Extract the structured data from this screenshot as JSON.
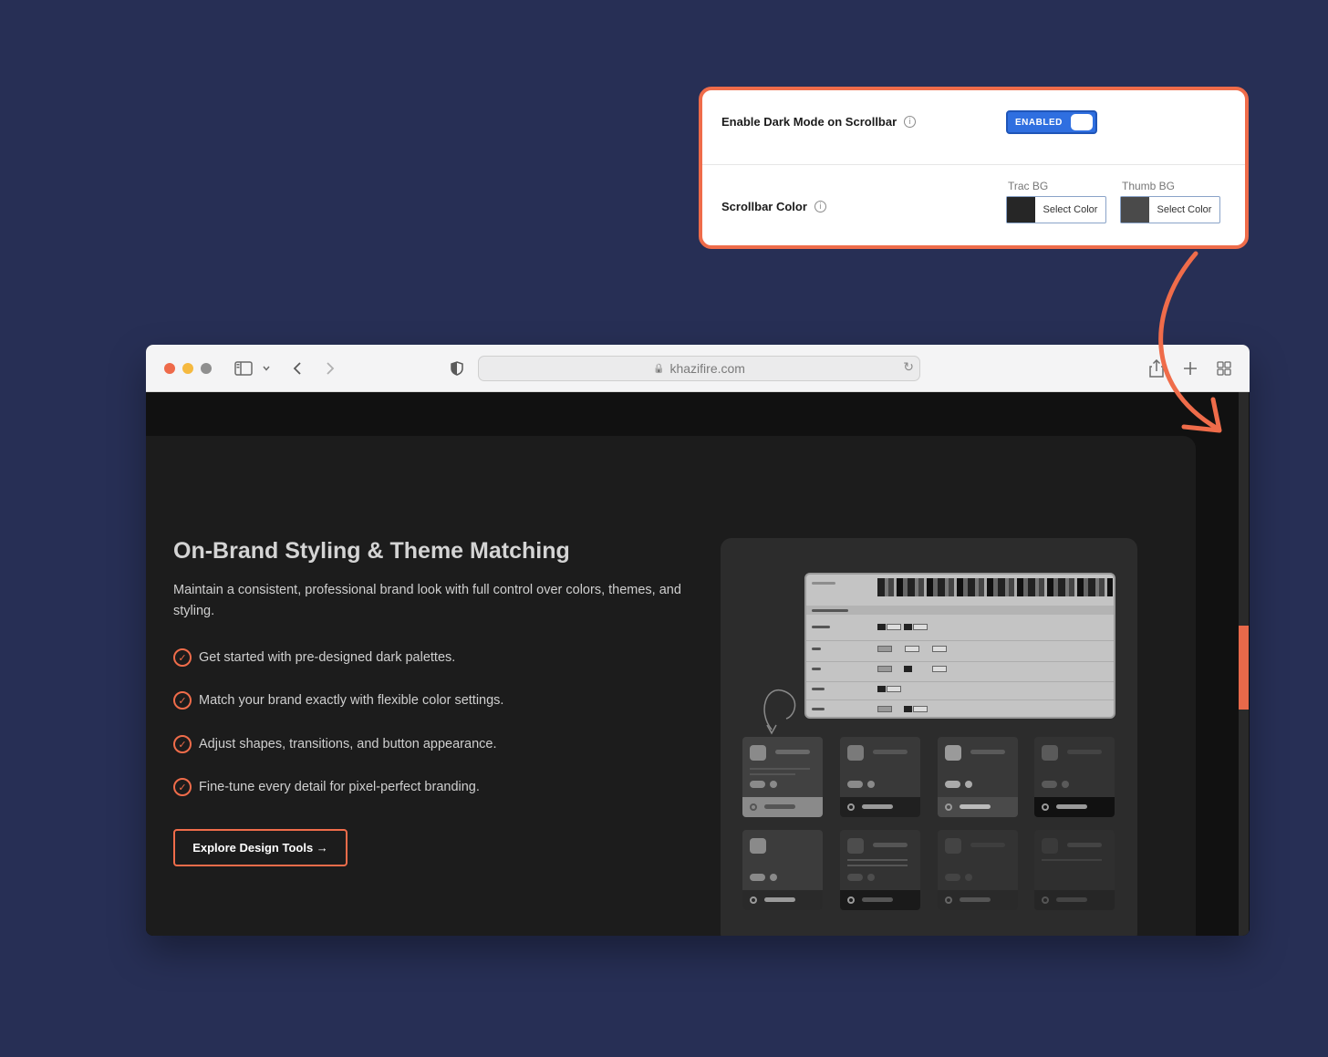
{
  "settings": {
    "dark_mode_label": "Enable Dark Mode on Scrollbar",
    "toggle_text": "ENABLED",
    "scrollbar_color_label": "Scrollbar Color",
    "track_caption": "Trac BG",
    "thumb_caption": "Thumb BG",
    "select_color_label": "Select Color",
    "track_color": "#262626",
    "thumb_color": "#4a4a4a",
    "info_glyph": "i"
  },
  "browser": {
    "url": "khazifire.com",
    "lock_glyph": "🔒"
  },
  "page": {
    "heading": "On-Brand Styling & Theme Matching",
    "description": "Maintain a consistent, professional brand look with full control over colors, themes, and styling.",
    "features": [
      "Get started with pre-designed dark palettes.",
      "Match your brand exactly with flexible color settings.",
      "Adjust shapes, transitions, and button appearance.",
      "Fine-tune every detail for pixel-perfect branding."
    ],
    "cta_label": "Explore Design Tools →"
  },
  "colors": {
    "accent": "#ef6c4a",
    "background": "#272f55",
    "toggle_blue": "#2f6fe0"
  }
}
